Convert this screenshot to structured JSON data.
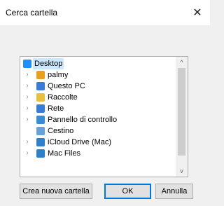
{
  "dialog": {
    "title": "Cerca cartella",
    "close_glyph": "✕"
  },
  "tree": {
    "items": [
      {
        "label": "Desktop",
        "icon": "desktop-icon",
        "color": "#1e90ff",
        "chevron": "",
        "selected": true
      },
      {
        "label": "palmy",
        "icon": "user-icon",
        "color": "#e8a020",
        "chevron": "›"
      },
      {
        "label": "Questo PC",
        "icon": "computer-icon",
        "color": "#3a7bd5",
        "chevron": "›"
      },
      {
        "label": "Raccolte",
        "icon": "libraries-icon",
        "color": "#e8c040",
        "chevron": "›"
      },
      {
        "label": "Rete",
        "icon": "network-icon",
        "color": "#3a7bd5",
        "chevron": "›"
      },
      {
        "label": "Pannello di controllo",
        "icon": "control-panel-icon",
        "color": "#3a8ad5",
        "chevron": "›"
      },
      {
        "label": "Cestino",
        "icon": "recycle-bin-icon",
        "color": "#6aa0d8",
        "chevron": ""
      },
      {
        "label": "iCloud Drive (Mac)",
        "icon": "folder-icon",
        "color": "#2f80c8",
        "chevron": "›"
      },
      {
        "label": "Mac Files",
        "icon": "folder-icon",
        "color": "#2f80c8",
        "chevron": "›"
      }
    ],
    "scroll_up_glyph": "^",
    "scroll_down_glyph": "v"
  },
  "buttons": {
    "new_folder": "Crea nuova cartella",
    "ok": "OK",
    "cancel": "Annulla"
  }
}
